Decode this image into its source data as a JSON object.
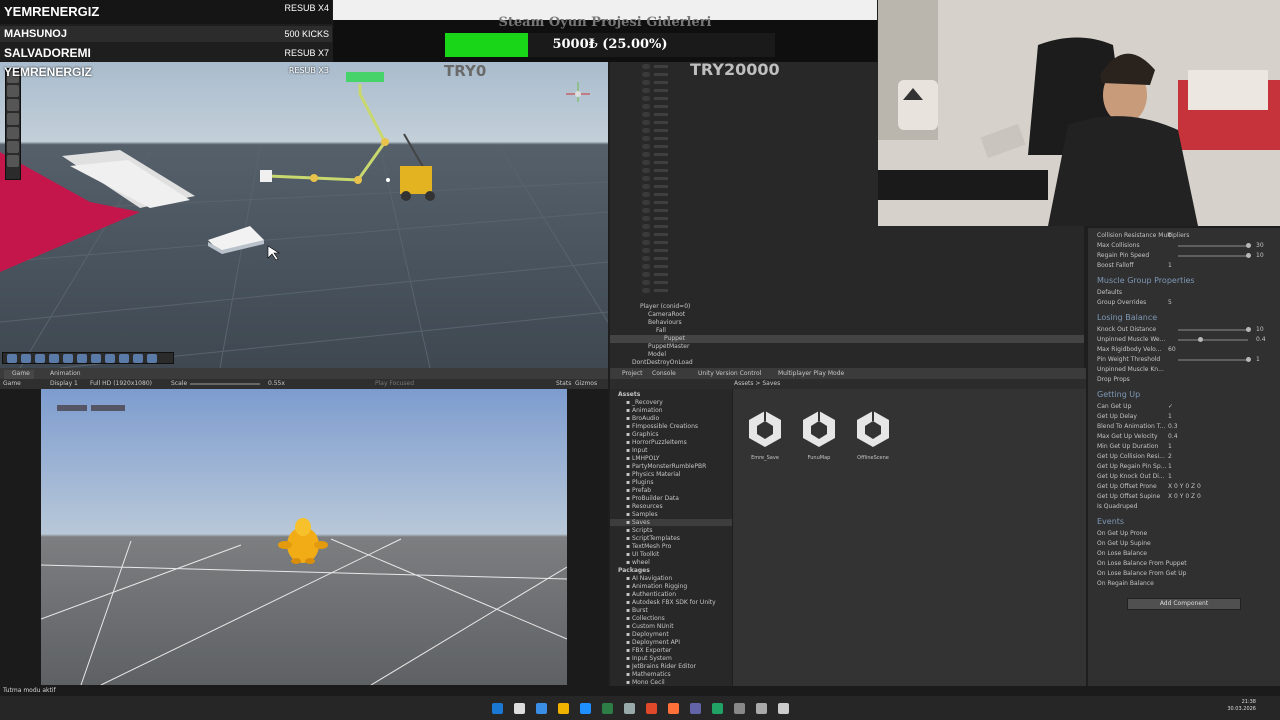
{
  "leaderboard": [
    {
      "name": "YEMRENERGIZ",
      "reward": "RESUB X4"
    },
    {
      "name": "MAHSUNOJ",
      "reward": "500 KICKS"
    },
    {
      "name": "SALVADOREMI",
      "reward": "RESUB X7"
    },
    {
      "name": "YEMRENERGIZ",
      "reward": "RESUB X3"
    }
  ],
  "donation": {
    "title": "Steam Oyun Projesi Giderleri",
    "amount": "5000₺ (25.00%)",
    "progress_fraction": 0.25,
    "currency_left": "TRY0",
    "currency_right": "TRY20000",
    "bar_color": "#19d619"
  },
  "hierarchy": {
    "items": [
      {
        "label": "CameraRoot",
        "indent": 1
      },
      {
        "label": "Behaviours",
        "indent": 1
      },
      {
        "label": "Fall",
        "indent": 2
      },
      {
        "label": "Puppet",
        "indent": 2,
        "selected": true
      },
      {
        "label": "PuppetMaster",
        "indent": 1
      },
      {
        "label": "Model",
        "indent": 1
      },
      {
        "label": "DontDestroyOnLoad",
        "indent": 0
      }
    ],
    "player": "Player (conid=0)"
  },
  "inspector": {
    "collision": [
      {
        "label": "Collision Resistance Multipliers",
        "value": "0"
      },
      {
        "label": "Max Collisions",
        "value": "30"
      },
      {
        "label": "Regain Pin Speed",
        "value": "10"
      },
      {
        "label": "Boost Falloff",
        "value": "1"
      }
    ],
    "muscle_header": "Muscle Group Properties",
    "muscle_rows": [
      {
        "label": "Defaults",
        "value": ""
      },
      {
        "label": "Group Overrides",
        "value": "5"
      }
    ],
    "losing_header": "Losing Balance",
    "losing_rows": [
      {
        "label": "Knock Out Distance",
        "value": "10"
      },
      {
        "label": "Unpinned Muscle We...",
        "value": "0.4"
      },
      {
        "label": "Max Rigidbody Velo...",
        "value": "60"
      },
      {
        "label": "Pin Weight Threshold",
        "value": "1"
      },
      {
        "label": "Unpinned Muscle Kn...",
        "value": ""
      },
      {
        "label": "Drop Props",
        "value": ""
      }
    ],
    "getting_header": "Getting Up",
    "getting_rows": [
      {
        "label": "Can Get Up",
        "value": "✓"
      },
      {
        "label": "Get Up Delay",
        "value": "1"
      },
      {
        "label": "Blend To Animation T...",
        "value": "0.3"
      },
      {
        "label": "Max Get Up Velocity",
        "value": "0.4"
      },
      {
        "label": "Min Get Up Duration",
        "value": "1"
      },
      {
        "label": "Get Up Collision Resi...",
        "value": "2"
      },
      {
        "label": "Get Up Regain Pin Sp...",
        "value": "1"
      },
      {
        "label": "Get Up Knock Out Di...",
        "value": "1"
      },
      {
        "label": "Get Up Offset Prone",
        "value": "X 0    Y 0    Z 0"
      },
      {
        "label": "Get Up Offset Supine",
        "value": "X 0    Y 0    Z 0"
      },
      {
        "label": "Is Quadruped",
        "value": ""
      }
    ],
    "events_header": "Events",
    "events": [
      "On Get Up Prone",
      "On Get Up Supine",
      "On Lose Balance",
      "On Lose Balance From Puppet",
      "On Lose Balance From Get Up",
      "On Regain Balance"
    ],
    "add_component": "Add Component"
  },
  "game": {
    "tab_game": "Game",
    "tab_animation": "Animation",
    "display": "Display 1",
    "resolution": "Full HD (1920x1080)",
    "scale_label": "Scale",
    "scale_value": "0.55x",
    "play_focused": "Play Focused",
    "stats": "Stats",
    "gizmos": "Gizmos"
  },
  "project": {
    "tabs": [
      "Project",
      "Console",
      "Unity Version Control",
      "Multiplayer Play Mode"
    ],
    "breadcrumb": "Assets  >  Saves",
    "tree_assets": "Assets",
    "tree": [
      "_Recovery",
      "Animation",
      "BroAudio",
      "FImpossible Creations",
      "Graphics",
      "HorrorPuzzleItems",
      "Input",
      "LMHPOLY",
      "PartyMonsterRumblePBR",
      "Physics Material",
      "Plugins",
      "Prefab",
      "ProBuilder Data",
      "Resources",
      "Samples",
      "Saves",
      "Scripts",
      "ScriptTemplates",
      "TextMesh Pro",
      "UI Toolkit",
      "wheel"
    ],
    "selected": "Saves",
    "tree_packages": "Packages",
    "packages": [
      "AI Navigation",
      "Animation Rigging",
      "Authentication",
      "Autodesk FBX SDK for Unity",
      "Burst",
      "Collections",
      "Custom NUnit",
      "Deployment",
      "Deployment API",
      "FBX Exporter",
      "Input System",
      "JetBrains Rider Editor",
      "Mathematics",
      "Mono Cecil"
    ],
    "files": [
      "Emre_Save",
      "FunuMap",
      "OfflineScene"
    ]
  },
  "status": {
    "text": "Tutma modu aktif"
  },
  "tray": {
    "time": "21:38",
    "date": "30.03.2026"
  }
}
